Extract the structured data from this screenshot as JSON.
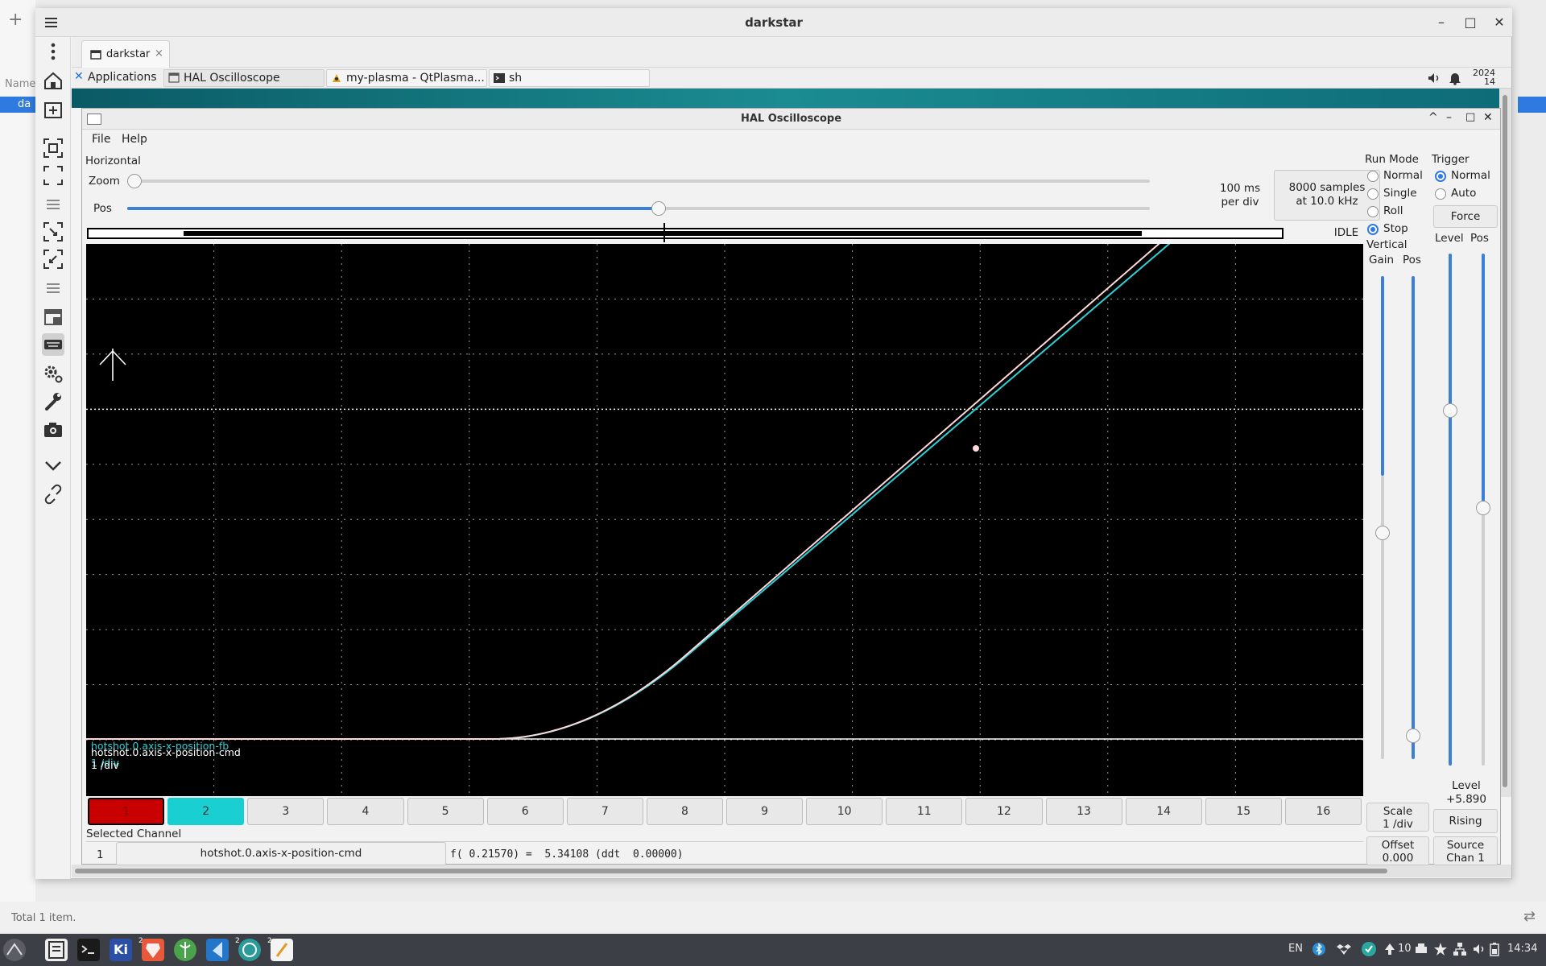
{
  "background": {
    "name_col": "Name",
    "selected_item": "da",
    "status_text": "Total 1 item."
  },
  "outer_window": {
    "title": "darkstar",
    "tab_label": "darkstar",
    "tab_close": "×"
  },
  "panel": {
    "applications": "Applications",
    "tasks": [
      "HAL Oscilloscope",
      "my-plasma - QtPlasma...",
      "sh"
    ],
    "clock_partial": "2024",
    "clock_partial2": "14"
  },
  "scope": {
    "title": "HAL Oscilloscope",
    "menu": [
      "File",
      "Help"
    ],
    "horizontal": {
      "group_label": "Horizontal",
      "zoom_label": "Zoom",
      "pos_label": "Pos",
      "zoom_value": 0.0,
      "pos_value": 0.52,
      "timebase_line1": "100 ms",
      "timebase_line2": "per div",
      "samples_line1": "8000 samples",
      "samples_line2": "at 10.0 kHz",
      "state": "IDLE"
    },
    "run_mode": {
      "label": "Run Mode",
      "options": [
        "Normal",
        "Single",
        "Roll",
        "Stop"
      ],
      "selected": "Stop"
    },
    "trigger": {
      "label": "Trigger",
      "options": [
        "Normal",
        "Auto"
      ],
      "selected": "Normal",
      "force": "Force",
      "level_col": "Level",
      "pos_col": "Pos",
      "level_label": "Level",
      "level_value": "+5.890",
      "edge": "Rising",
      "source_line1": "Source",
      "source_line2": "Chan  1"
    },
    "vertical": {
      "label": "Vertical",
      "gain_col": "Gain",
      "pos_col": "Pos",
      "scale_label": "Scale",
      "scale_value": "1 /div",
      "offset_label": "Offset",
      "offset_value": "0.000"
    },
    "screen": {
      "chan2_name": "hotshot.0.axis-x-position-fb",
      "chan1_name": "hotshot.0.axis-x-position-cmd",
      "scale_text": "1 /div",
      "colors": {
        "chan1": "#ffd9d9",
        "chan2": "#2fd0d8",
        "grid": "#9a9a9a"
      }
    },
    "channels": [
      "1",
      "2",
      "3",
      "4",
      "5",
      "6",
      "7",
      "8",
      "9",
      "10",
      "11",
      "12",
      "13",
      "14",
      "15",
      "16"
    ],
    "channel_colors": {
      "1": "#c80000",
      "2": "#19cfd2"
    },
    "selected_channel": {
      "label": "Selected Channel",
      "number": "1",
      "name": "hotshot.0.axis-x-position-cmd",
      "readout": "f( 0.21570) =  5.34108 (ddt  0.00000)"
    }
  },
  "taskbar": {
    "tray_lang": "EN",
    "tray_num": "10",
    "clock": "14:34",
    "badges": [
      "2",
      "2",
      "2"
    ]
  }
}
